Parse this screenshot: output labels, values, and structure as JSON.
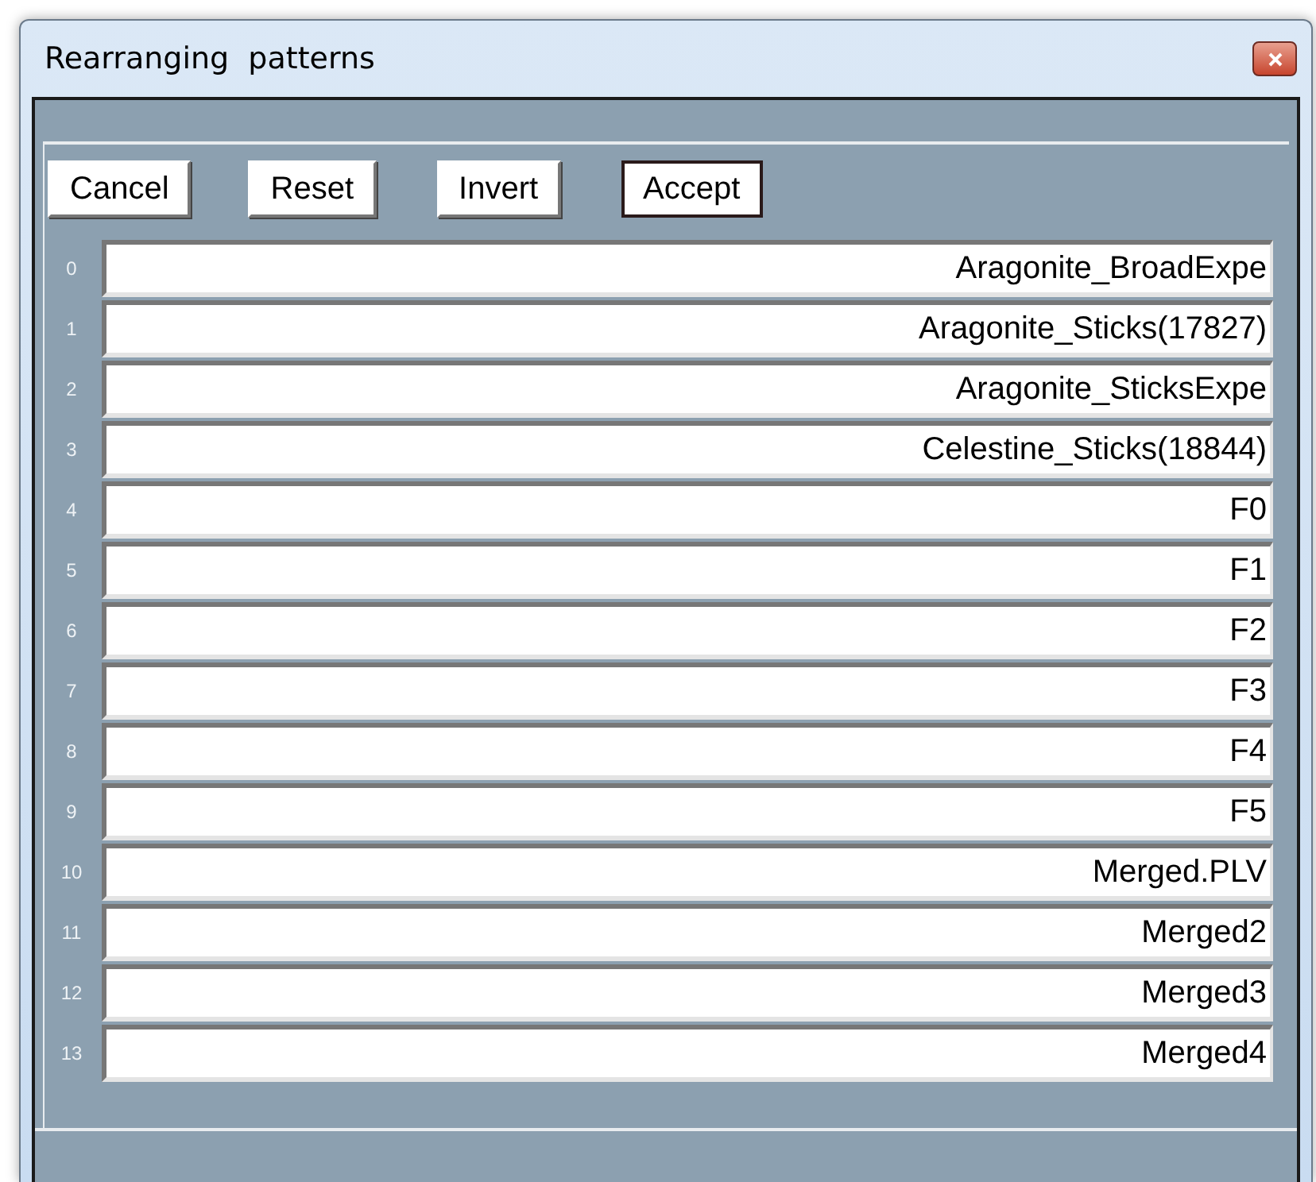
{
  "window": {
    "title": "Rearranging  patterns"
  },
  "buttons": [
    {
      "label": "Cancel",
      "default": false
    },
    {
      "label": "Reset",
      "default": false
    },
    {
      "label": "Invert",
      "default": false
    },
    {
      "label": "Accept",
      "default": true
    }
  ],
  "patterns": [
    {
      "index": "0",
      "name": "Aragonite_BroadExpe"
    },
    {
      "index": "1",
      "name": "Aragonite_Sticks(17827)"
    },
    {
      "index": "2",
      "name": "Aragonite_SticksExpe"
    },
    {
      "index": "3",
      "name": "Celestine_Sticks(18844)"
    },
    {
      "index": "4",
      "name": "F0"
    },
    {
      "index": "5",
      "name": "F1"
    },
    {
      "index": "6",
      "name": "F2"
    },
    {
      "index": "7",
      "name": "F3"
    },
    {
      "index": "8",
      "name": "F4"
    },
    {
      "index": "9",
      "name": "F5"
    },
    {
      "index": "10",
      "name": "Merged.PLV"
    },
    {
      "index": "11",
      "name": "Merged2"
    },
    {
      "index": "12",
      "name": "Merged3"
    },
    {
      "index": "13",
      "name": "Merged4"
    }
  ]
}
